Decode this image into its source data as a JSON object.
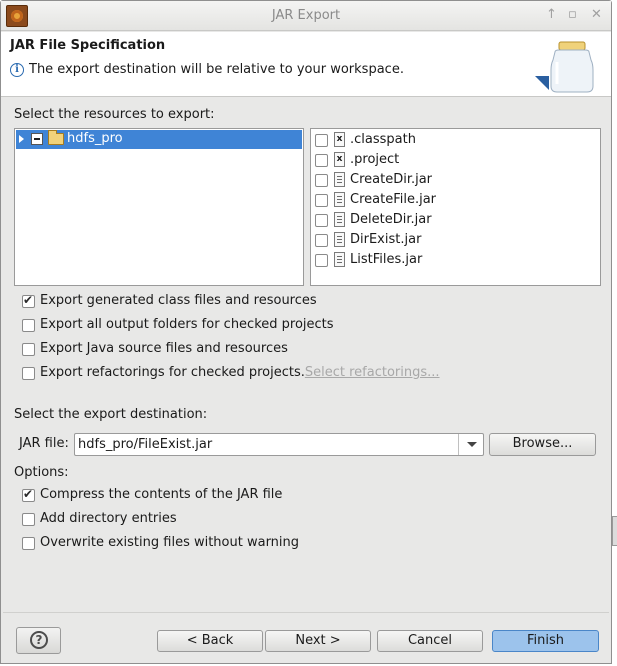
{
  "window": {
    "title": "JAR Export"
  },
  "header": {
    "title": "JAR File Specification",
    "message": "The export destination will be relative to your workspace."
  },
  "resources": {
    "label": "Select the resources to export:",
    "project": "hdfs_pro",
    "files": [
      {
        "name": ".classpath",
        "icon": "xml-file-icon",
        "checked": false
      },
      {
        "name": ".project",
        "icon": "xml-file-icon",
        "checked": false
      },
      {
        "name": "CreateDir.jar",
        "icon": "file-icon",
        "checked": false
      },
      {
        "name": "CreateFile.jar",
        "icon": "file-icon",
        "checked": false
      },
      {
        "name": "DeleteDir.jar",
        "icon": "file-icon",
        "checked": false
      },
      {
        "name": "DirExist.jar",
        "icon": "file-icon",
        "checked": false
      },
      {
        "name": "ListFiles.jar",
        "icon": "file-icon",
        "checked": false
      }
    ]
  },
  "export_options": {
    "generated_class": {
      "label": "Export generated class files and resources",
      "checked": true
    },
    "output_folders": {
      "label": "Export all output folders for checked projects",
      "checked": false
    },
    "java_source": {
      "label": "Export Java source files and resources",
      "checked": false
    },
    "refactorings": {
      "label": "Export refactorings for checked projects.",
      "checked": false
    },
    "select_refactorings": "Select refactorings..."
  },
  "destination": {
    "label": "Select the export destination:",
    "jar_file_label": "JAR file:",
    "jar_file_value": "hdfs_pro/FileExist.jar",
    "browse": "Browse..."
  },
  "options": {
    "label": "Options:",
    "compress": {
      "label": "Compress the contents of the JAR file",
      "checked": true
    },
    "directory_entries": {
      "label": "Add directory entries",
      "checked": false
    },
    "overwrite": {
      "label": "Overwrite existing files without warning",
      "checked": false
    }
  },
  "buttons": {
    "help": "?",
    "back": "< Back",
    "next": "Next >",
    "cancel": "Cancel",
    "finish": "Finish"
  },
  "colors": {
    "selection": "#3f84d6",
    "primary_button": "#9cc3ec"
  }
}
